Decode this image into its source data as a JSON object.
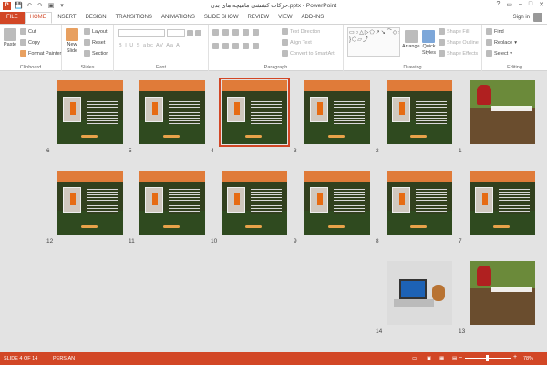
{
  "app": {
    "title": "حرکات کششی ماهیچه های بدن.pptx - PowerPoint",
    "sign_in": "Sign in",
    "window_buttons": [
      "?",
      "▭",
      "–",
      "□",
      "✕"
    ]
  },
  "qat": {
    "app_icon": "P",
    "save": "💾",
    "undo": "↶",
    "redo": "↷",
    "start": "▣",
    "customize": "▾"
  },
  "tabs": [
    "FILE",
    "HOME",
    "INSERT",
    "DESIGN",
    "TRANSITIONS",
    "ANIMATIONS",
    "SLIDE SHOW",
    "REVIEW",
    "VIEW",
    "ADD-INS"
  ],
  "active_tab": "HOME",
  "ribbon": {
    "clipboard": {
      "label": "Clipboard",
      "paste": "Paste",
      "cut": "Cut",
      "copy": "Copy",
      "format_painter": "Format Painter"
    },
    "slides": {
      "label": "Slides",
      "new_slide": "New",
      "new_slide2": "Slide",
      "layout": "Layout",
      "reset": "Reset",
      "section": "Section"
    },
    "font": {
      "label": "Font",
      "row2": "B I U S abc AV Aa A"
    },
    "paragraph": {
      "label": "Paragraph",
      "text_direction": "Text Direction",
      "align_text": "Align Text",
      "convert_smartart": "Convert to SmartArt"
    },
    "drawing": {
      "label": "Drawing",
      "arrange": "Arrange",
      "quick_styles": "Quick",
      "quick_styles2": "Styles",
      "shape_fill": "Shape Fill",
      "shape_outline": "Shape Outline",
      "shape_effects": "Shape Effects",
      "shapes_glyphs": "▭○△▷⬠↗↘⌒◇☆{ }⬡▱⤴"
    },
    "editing": {
      "label": "Editing",
      "find": "Find",
      "replace": "Replace",
      "select": "Select"
    }
  },
  "slides": [
    {
      "n": "1",
      "type": "title"
    },
    {
      "n": "2",
      "type": "content"
    },
    {
      "n": "3",
      "type": "content"
    },
    {
      "n": "4",
      "type": "content",
      "selected": true
    },
    {
      "n": "5",
      "type": "content"
    },
    {
      "n": "6",
      "type": "content"
    },
    {
      "n": "7",
      "type": "content"
    },
    {
      "n": "8",
      "type": "content"
    },
    {
      "n": "9",
      "type": "content"
    },
    {
      "n": "10",
      "type": "content"
    },
    {
      "n": "11",
      "type": "content"
    },
    {
      "n": "12",
      "type": "content"
    },
    {
      "n": "13",
      "type": "title"
    },
    {
      "n": "14",
      "type": "laptop"
    }
  ],
  "status": {
    "slide_info": "SLIDE 4 OF 14",
    "language": "PERSIAN",
    "zoom": "78%"
  },
  "colors": {
    "accent": "#d24726",
    "sorter_bg": "#e3e3e3",
    "slide_band": "#e07b39"
  }
}
